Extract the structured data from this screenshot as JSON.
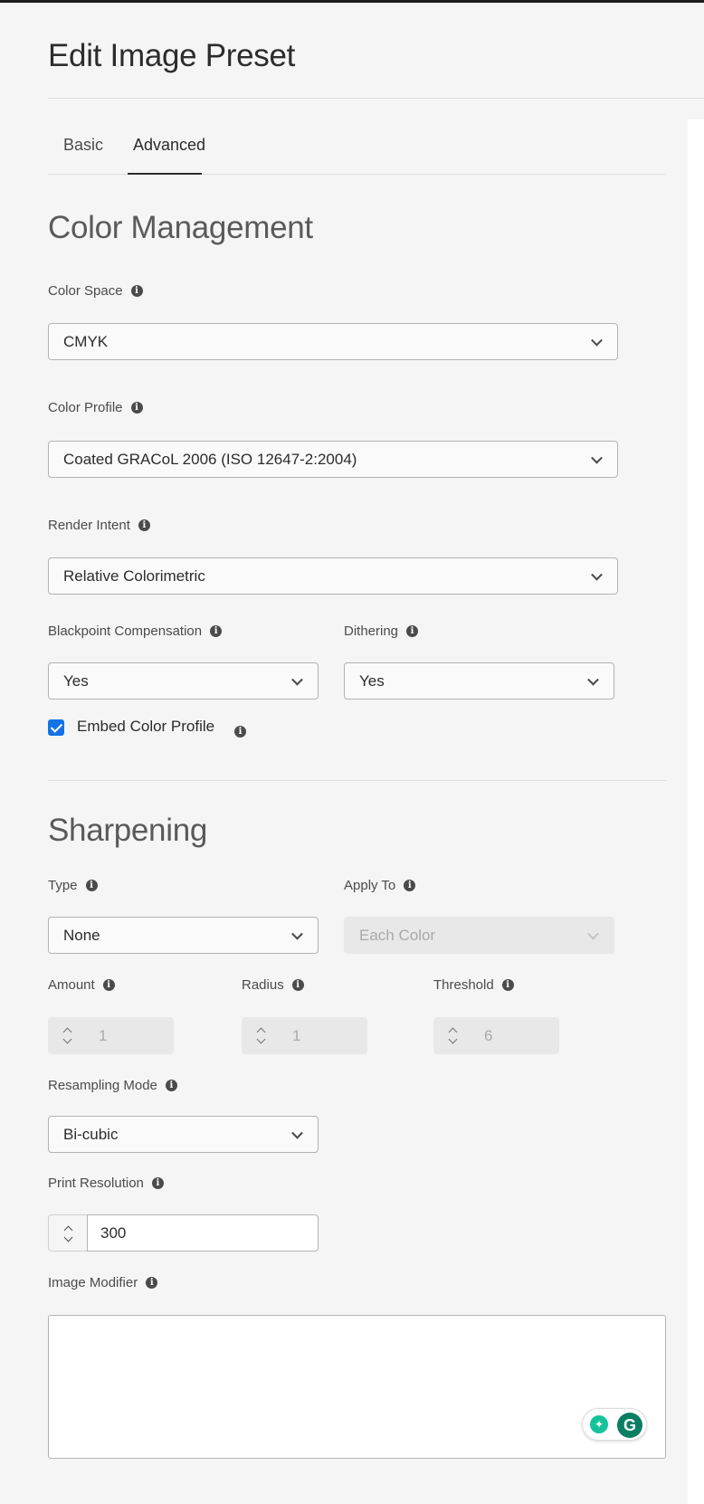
{
  "page": {
    "title": "Edit Image Preset"
  },
  "tabs": [
    {
      "label": "Basic",
      "active": false
    },
    {
      "label": "Advanced",
      "active": true
    }
  ],
  "color_management": {
    "title": "Color Management",
    "color_space": {
      "label": "Color Space",
      "value": "CMYK"
    },
    "color_profile": {
      "label": "Color Profile",
      "value": "Coated GRACoL 2006 (ISO 12647-2:2004)"
    },
    "render_intent": {
      "label": "Render Intent",
      "value": "Relative Colorimetric"
    },
    "blackpoint_compensation": {
      "label": "Blackpoint Compensation",
      "value": "Yes"
    },
    "dithering": {
      "label": "Dithering",
      "value": "Yes"
    },
    "embed_color_profile": {
      "label": "Embed Color Profile",
      "checked": true
    }
  },
  "sharpening": {
    "title": "Sharpening",
    "type": {
      "label": "Type",
      "value": "None"
    },
    "apply_to": {
      "label": "Apply To",
      "value": "Each Color",
      "disabled": true
    },
    "amount": {
      "label": "Amount",
      "value": "1"
    },
    "radius": {
      "label": "Radius",
      "value": "1"
    },
    "threshold": {
      "label": "Threshold",
      "value": "6"
    },
    "resampling_mode": {
      "label": "Resampling Mode",
      "value": "Bi-cubic"
    },
    "print_resolution": {
      "label": "Print Resolution",
      "value": "300"
    },
    "image_modifier": {
      "label": "Image Modifier",
      "value": ""
    }
  },
  "icons": {
    "info": "info-icon",
    "chevron": "chevron-down-icon",
    "grammarly": "grammarly-icon",
    "bulb": "lightbulb-icon"
  },
  "colors": {
    "accent": "#1473e6",
    "text": "#2c2c2c",
    "background": "#f5f5f5",
    "grammarly": "#15c39a"
  }
}
